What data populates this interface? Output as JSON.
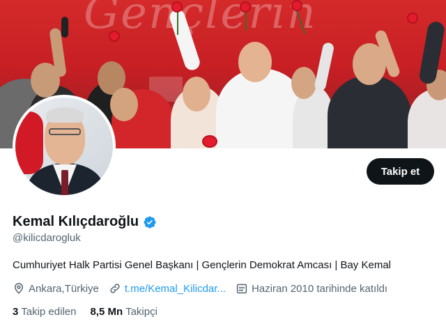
{
  "profile": {
    "display_name": "Kemal Kılıçdaroğlu",
    "handle": "@kilicdarogluk",
    "bio": "Cumhuriyet Halk Partisi Genel Başkanı | Gençlerin Demokrat Amcası | Bay Kemal",
    "verified_icon": "verified-badge-icon",
    "follow_label": "Takip et"
  },
  "meta": {
    "location": "Ankara,Türkiye",
    "location_icon": "location-pin-icon",
    "link": "t.me/Kemal_Kilicdar...",
    "link_icon": "link-icon",
    "joined": "Haziran 2010 tarihinde katıldı",
    "joined_icon": "calendar-icon"
  },
  "stats": {
    "following_count": "3",
    "following_label": "Takip edilen",
    "followers_count": "8,5 Mn",
    "followers_label": "Takipçi"
  },
  "colors": {
    "accent": "#1d9bf0",
    "button_bg": "#0f1419",
    "secondary_text": "#536471",
    "banner_red": "#c71f24"
  }
}
